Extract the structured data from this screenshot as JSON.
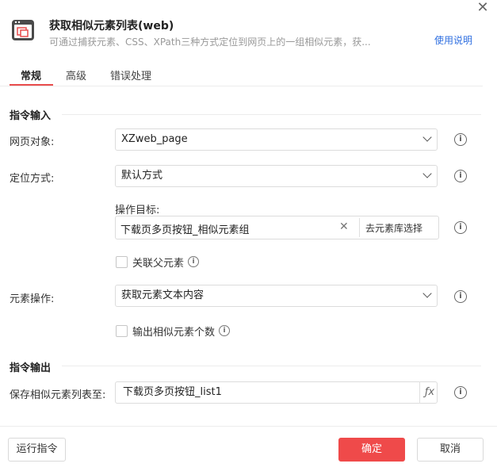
{
  "header": {
    "title": "获取相似元素列表(web)",
    "description": "可通过捕获元素、CSS、XPath三种方式定位到网页上的一组相似元素，获...",
    "help_link": "使用说明",
    "close_icon": "close-icon",
    "logo_icon": "browser-list-icon",
    "accent_color": "#e84c4c"
  },
  "tabs": [
    {
      "label": "常规",
      "active": true
    },
    {
      "label": "高级",
      "active": false
    },
    {
      "label": "错误处理",
      "active": false
    }
  ],
  "input_section": {
    "title": "指令输入",
    "web_object": {
      "label": "网页对象:",
      "value": "XZweb_page"
    },
    "locate_method": {
      "label": "定位方式:",
      "value": "默认方式"
    },
    "target": {
      "label": "操作目标:",
      "value": "下载页多页按钮_相似元素组",
      "library_button": "去元素库选择"
    },
    "associate_parent": {
      "label": "关联父元素",
      "checked": false
    },
    "element_operation": {
      "label": "元素操作:",
      "value": "获取元素文本内容"
    },
    "output_count": {
      "label": "输出相似元素个数",
      "checked": false
    }
  },
  "output_section": {
    "title": "指令输出",
    "save_list": {
      "label": "保存相似元素列表至:",
      "value": "下载页多页按钮_list1",
      "fx": "ƒx"
    }
  },
  "footer": {
    "run_button": "运行指令",
    "confirm_button": "确定",
    "cancel_button": "取消",
    "primary_color": "#ef4a4a"
  }
}
